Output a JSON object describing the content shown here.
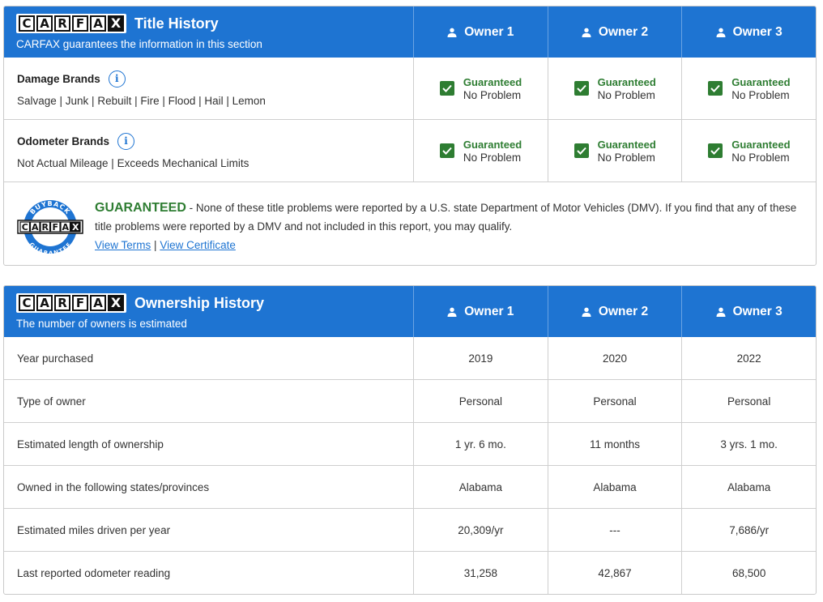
{
  "title_history": {
    "logo_letters": [
      "C",
      "A",
      "R",
      "F",
      "A",
      "X"
    ],
    "title": "Title History",
    "subtitle": "CARFAX guarantees the information in this section",
    "owners": [
      "Owner 1",
      "Owner 2",
      "Owner 3"
    ],
    "rows": [
      {
        "label": "Damage Brands",
        "desc": "Salvage | Junk | Rebuilt | Fire | Flood | Hail | Lemon",
        "cells": [
          {
            "status": "Guaranteed",
            "detail": "No Problem"
          },
          {
            "status": "Guaranteed",
            "detail": "No Problem"
          },
          {
            "status": "Guaranteed",
            "detail": "No Problem"
          }
        ]
      },
      {
        "label": "Odometer Brands",
        "desc": "Not Actual Mileage | Exceeds Mechanical Limits",
        "cells": [
          {
            "status": "Guaranteed",
            "detail": "No Problem"
          },
          {
            "status": "Guaranteed",
            "detail": "No Problem"
          },
          {
            "status": "Guaranteed",
            "detail": "No Problem"
          }
        ]
      }
    ],
    "guarantee": {
      "badge_top": "BUYBACK",
      "badge_bottom": "GUARANTEE",
      "heading": "GUARANTEED",
      "text": " - None of these title problems were reported by a U.S. state Department of Motor Vehicles (DMV). If you find that any of these title problems were reported by a DMV and not included in this report, you may qualify.",
      "link_terms": "View Terms",
      "separator": "|",
      "link_certificate": "View Certificate"
    }
  },
  "ownership_history": {
    "logo_letters": [
      "C",
      "A",
      "R",
      "F",
      "A",
      "X"
    ],
    "title": "Ownership History",
    "subtitle": "The number of owners is estimated",
    "owners": [
      "Owner 1",
      "Owner 2",
      "Owner 3"
    ],
    "rows": [
      {
        "label": "Year purchased",
        "values": [
          "2019",
          "2020",
          "2022"
        ]
      },
      {
        "label": "Type of owner",
        "values": [
          "Personal",
          "Personal",
          "Personal"
        ]
      },
      {
        "label": "Estimated length of ownership",
        "values": [
          "1 yr. 6 mo.",
          "11 months",
          "3 yrs. 1 mo."
        ]
      },
      {
        "label": "Owned in the following states/provinces",
        "values": [
          "Alabama",
          "Alabama",
          "Alabama"
        ]
      },
      {
        "label": "Estimated miles driven per year",
        "values": [
          "20,309/yr",
          "---",
          "7,686/yr"
        ]
      },
      {
        "label": "Last reported odometer reading",
        "values": [
          "31,258",
          "42,867",
          "68,500"
        ]
      }
    ]
  },
  "colors": {
    "header_blue": "#1e74d2",
    "guaranteed_green": "#2e7d32",
    "link_blue": "#1e74d2"
  },
  "icons": {
    "owner": "person-icon",
    "info": "info-icon",
    "check": "checkmark-icon",
    "badge": "buyback-guarantee-badge"
  }
}
